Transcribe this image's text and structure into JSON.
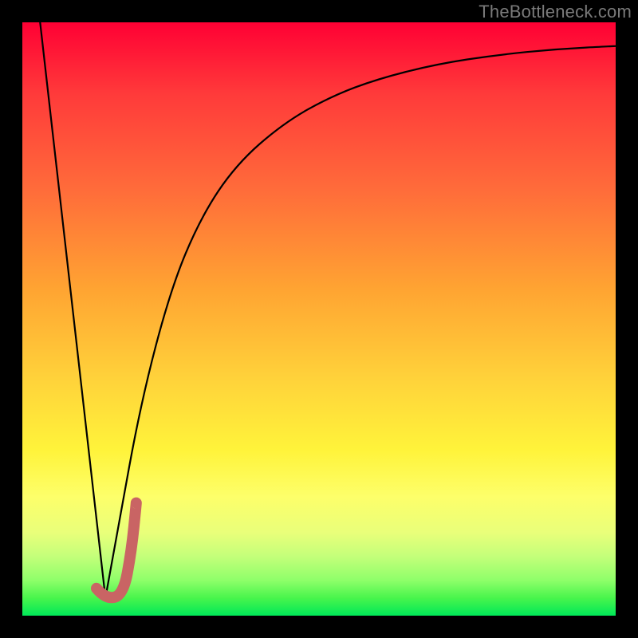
{
  "watermark": "TheBottleneck.com",
  "chart_data": {
    "type": "line",
    "title": "",
    "xlabel": "",
    "ylabel": "",
    "xlim": [
      0,
      100
    ],
    "ylim": [
      0,
      100
    ],
    "series": [
      {
        "name": "left-descent",
        "x": [
          3,
          14
        ],
        "y": [
          100,
          3
        ]
      },
      {
        "name": "right-curve",
        "x": [
          14,
          16,
          20,
          25,
          30,
          36,
          44,
          52,
          60,
          70,
          80,
          90,
          100
        ],
        "y": [
          3,
          14,
          36,
          55,
          67,
          76,
          83,
          87.5,
          90.5,
          93,
          94.5,
          95.5,
          96
        ]
      },
      {
        "name": "highlight-hook",
        "x": [
          12.5,
          14,
          17,
          18.4,
          19.2
        ],
        "y": [
          4.6,
          2.8,
          3.4,
          11,
          19
        ]
      }
    ],
    "colors": {
      "curve": "#000000",
      "highlight": "#c96464"
    }
  }
}
